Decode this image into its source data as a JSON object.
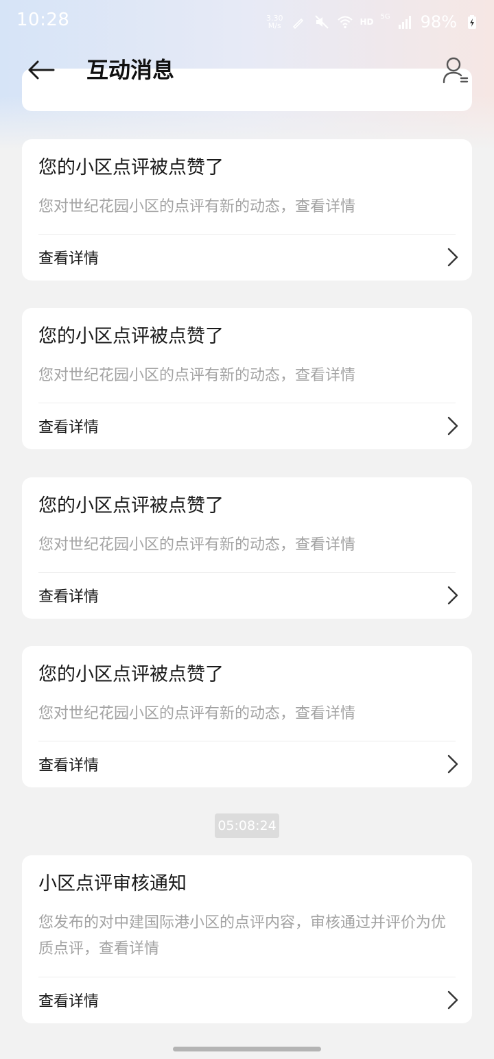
{
  "status_bar": {
    "time": "10:28",
    "net_speed_value": "3.30",
    "net_speed_unit": "M/s",
    "hd": "HD",
    "signal_label": "5G",
    "battery": "98%",
    "icons": [
      "pencil-icon",
      "mute-icon",
      "wifi-icon",
      "signal-icon",
      "battery-charging-icon"
    ]
  },
  "header": {
    "title": "互动消息",
    "back_icon": "arrow-left-icon",
    "profile_icon": "user-list-icon"
  },
  "messages": [
    {
      "title": "您的小区点评被点赞了",
      "desc": "您对世纪花园小区的点评有新的动态，查看详情",
      "link": "查看详情"
    },
    {
      "title": "您的小区点评被点赞了",
      "desc": "您对世纪花园小区的点评有新的动态，查看详情",
      "link": "查看详情"
    },
    {
      "title": "您的小区点评被点赞了",
      "desc": "您对世纪花园小区的点评有新的动态，查看详情",
      "link": "查看详情"
    },
    {
      "title": "您的小区点评被点赞了",
      "desc": "您对世纪花园小区的点评有新的动态，查看详情",
      "link": "查看详情"
    }
  ],
  "timestamp": "05:08:24",
  "audit_message": {
    "title": "小区点评审核通知",
    "desc": "您发布的对中建国际港小区的点评内容，审核通过并评价为优质点评，查看详情",
    "link": "查看详情"
  },
  "colors": {
    "background": "#f2f2f2",
    "card": "#ffffff",
    "muted_text": "#a3a3a3",
    "timestamp_chip": "#dcdcdc"
  }
}
